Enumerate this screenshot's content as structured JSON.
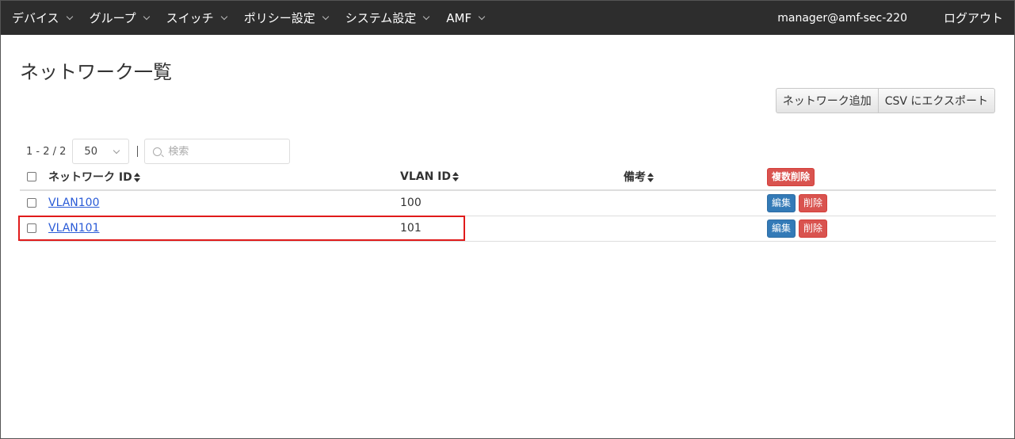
{
  "nav": {
    "items": [
      {
        "label": "デバイス"
      },
      {
        "label": "グループ"
      },
      {
        "label": "スイッチ"
      },
      {
        "label": "ポリシー設定"
      },
      {
        "label": "システム設定"
      },
      {
        "label": "AMF"
      }
    ],
    "user": "manager@amf-sec-220",
    "logout": "ログアウト"
  },
  "page": {
    "title": "ネットワーク一覧",
    "add_network": "ネットワーク追加",
    "export_csv": "CSV にエクスポート"
  },
  "toolbar": {
    "count": "1 - 2 / 2",
    "page_size": "50",
    "search_placeholder": "検索"
  },
  "table": {
    "columns": {
      "network_id": "ネットワーク ID",
      "vlan_id": "VLAN ID",
      "note": "備考"
    },
    "bulk_delete": "複数削除",
    "edit_label": "編集",
    "delete_label": "削除",
    "rows": [
      {
        "network_id": "VLAN100",
        "vlan_id": "100",
        "note": ""
      },
      {
        "network_id": "VLAN101",
        "vlan_id": "101",
        "note": ""
      }
    ]
  },
  "colors": {
    "highlight": "#e01b1b",
    "primary": "#337ab7",
    "danger": "#d9534f",
    "navbar": "#2d2d2d"
  }
}
